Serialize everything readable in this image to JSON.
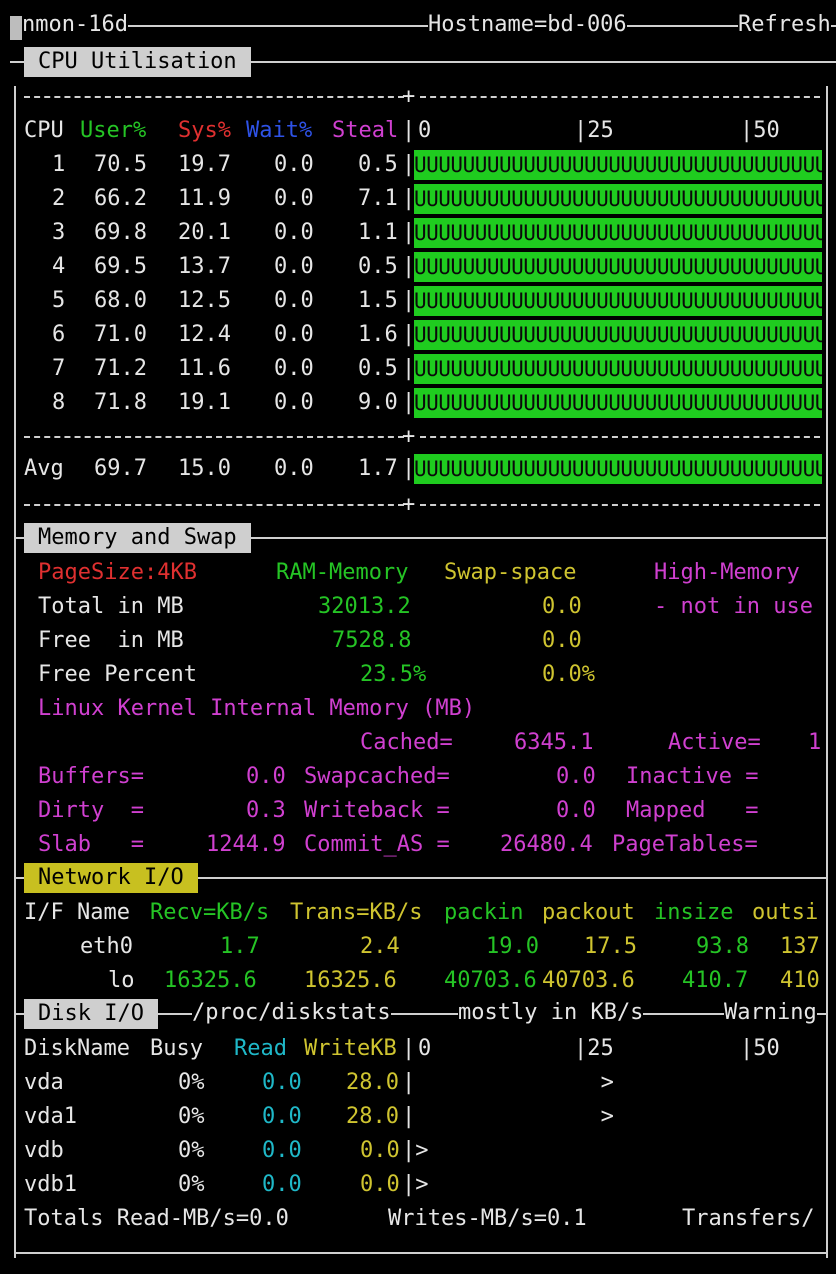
{
  "title_bar": {
    "app": "nmon-16d",
    "hostname": "Hostname=bd-006",
    "refresh": "Refresh"
  },
  "cpu": {
    "section_title": "CPU Utilisation",
    "headers": {
      "cpu": "CPU",
      "user": "User%",
      "sys": "Sys%",
      "wait": "Wait%",
      "steal": "Steal"
    },
    "scale": [
      "0",
      "|25",
      "|50"
    ],
    "rows": [
      {
        "cpu": "1",
        "user": "70.5",
        "sys": "19.7",
        "wait": "0.0",
        "steal": "0.5",
        "bar": "UUUUUUUUUUUUUUUUUUUUUUUUUUUUUUUUUUUUUUUUUUUUUU"
      },
      {
        "cpu": "2",
        "user": "66.2",
        "sys": "11.9",
        "wait": "0.0",
        "steal": "7.1",
        "bar": "UUUUUUUUUUUUUUUUUUUUUUUUUUUUUUUUUUUUUUUUUUUUUU"
      },
      {
        "cpu": "3",
        "user": "69.8",
        "sys": "20.1",
        "wait": "0.0",
        "steal": "1.1",
        "bar": "UUUUUUUUUUUUUUUUUUUUUUUUUUUUUUUUUUUUUUUUUUUUUU"
      },
      {
        "cpu": "4",
        "user": "69.5",
        "sys": "13.7",
        "wait": "0.0",
        "steal": "0.5",
        "bar": "UUUUUUUUUUUUUUUUUUUUUUUUUUUUUUUUUUUUUUUUUUUUUU"
      },
      {
        "cpu": "5",
        "user": "68.0",
        "sys": "12.5",
        "wait": "0.0",
        "steal": "1.5",
        "bar": "UUUUUUUUUUUUUUUUUUUUUUUUUUUUUUUUUUUUUUUUUUUUUU"
      },
      {
        "cpu": "6",
        "user": "71.0",
        "sys": "12.4",
        "wait": "0.0",
        "steal": "1.6",
        "bar": "UUUUUUUUUUUUUUUUUUUUUUUUUUUUUUUUUUUUUUUUUUUUUU"
      },
      {
        "cpu": "7",
        "user": "71.2",
        "sys": "11.6",
        "wait": "0.0",
        "steal": "0.5",
        "bar": "UUUUUUUUUUUUUUUUUUUUUUUUUUUUUUUUUUUUUUUUUUUUUU"
      },
      {
        "cpu": "8",
        "user": "71.8",
        "sys": "19.1",
        "wait": "0.0",
        "steal": "9.0",
        "bar": "UUUUUUUUUUUUUUUUUUUUUUUUUUUUUUUUUUUUUUUUUUUUUU"
      }
    ],
    "avg": {
      "cpu": "Avg",
      "user": "69.7",
      "sys": "15.0",
      "wait": "0.0",
      "steal": "1.7",
      "bar": "UUUUUUUUUUUUUUUUUUUUUUUUUUUUUUUUUUUUUUUUUUUUUU"
    }
  },
  "memory": {
    "section_title": "Memory and Swap",
    "pagesize": "PageSize:4KB",
    "ram_header": "RAM-Memory",
    "swap_header": "Swap-space",
    "high_header": "High-Memory",
    "total_label": "Total in MB",
    "total_ram": "32013.2",
    "total_swap": "0.0",
    "high_status": "- not in use",
    "free_label": "Free  in MB",
    "free_ram": "7528.8",
    "free_swap": "0.0",
    "freepct_label": "Free Percent",
    "freepct_ram": "23.5%",
    "freepct_swap": "0.0%",
    "kernel_title": "Linux Kernel Internal Memory (MB)",
    "cached_label": "Cached=",
    "cached_val": "6345.1",
    "active_label": "Active=",
    "active_val": "1",
    "buffers_label": "Buffers=",
    "buffers_val": "0.0",
    "swapcached_label": "Swapcached=",
    "swapcached_val": "0.0",
    "inactive_label": "Inactive =",
    "dirty_label": "Dirty  =",
    "dirty_val": "0.3",
    "writeback_label": "Writeback =",
    "writeback_val": "0.0",
    "mapped_label": "Mapped   =",
    "slab_label": "Slab   =",
    "slab_val": "1244.9",
    "commit_label": "Commit_AS =",
    "commit_val": "26480.4",
    "pagetables_label": "PageTables="
  },
  "network": {
    "section_title": "Network I/O",
    "headers": {
      "ifname": "I/F Name",
      "recv": "Recv=KB/s",
      "trans": "Trans=KB/s",
      "packin": "packin",
      "packout": "packout",
      "insize": "insize",
      "outsize": "outsi"
    },
    "rows": [
      {
        "name": "eth0",
        "recv": "1.7",
        "trans": "2.4",
        "packin": "19.0",
        "packout": "17.5",
        "insize": "93.8",
        "outsize": "137"
      },
      {
        "name": "lo",
        "recv": "16325.6",
        "trans": "16325.6",
        "packin": "40703.6",
        "packout": "40703.6",
        "insize": "410.7",
        "outsize": "410"
      }
    ]
  },
  "disk": {
    "section_title": "Disk I/O",
    "source": "/proc/diskstats",
    "units_note": "mostly in KB/s",
    "warning": "Warning",
    "headers": {
      "name": "DiskName",
      "busy": "Busy",
      "read": "Read",
      "write": "WriteKB"
    },
    "scale": [
      "0",
      "|25",
      "|50"
    ],
    "rows": [
      {
        "name": "vda",
        "busy": "0%",
        "read": "0.0",
        "write": "28.0",
        "marker": "|              >"
      },
      {
        "name": "vda1",
        "busy": "0%",
        "read": "0.0",
        "write": "28.0",
        "marker": "|              >"
      },
      {
        "name": "vdb",
        "busy": "0%",
        "read": "0.0",
        "write": "0.0",
        "marker": "|>"
      },
      {
        "name": "vdb1",
        "busy": "0%",
        "read": "0.0",
        "write": "0.0",
        "marker": "|>"
      }
    ],
    "totals_read": "Totals Read-MB/s=0.0",
    "totals_writes": "Writes-MB/s=0.1",
    "totals_transfers": "Transfers/"
  }
}
